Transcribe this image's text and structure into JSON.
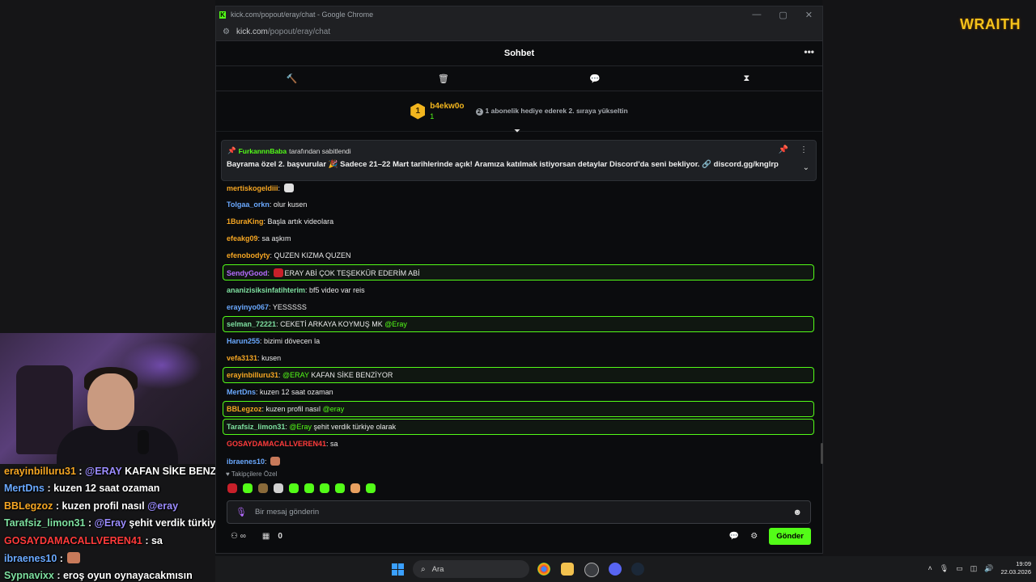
{
  "overlay": {
    "brand": "WRAITH",
    "chat": [
      {
        "user": "erayinbilluru31",
        "sep": " : ",
        "mention": "@ERAY",
        "text": " KAFAN SİKE BENZİYOR",
        "color": "#f5a623"
      },
      {
        "user": "MertDns",
        "sep": " : ",
        "mention": "",
        "text": "kuzen 12 saat ozaman",
        "color": "#6aa9ff"
      },
      {
        "user": "BBLegzoz",
        "sep": " : ",
        "mention": "",
        "text": "kuzen profil nasıl ",
        "mention2": "@eray",
        "color": "#f5a623"
      },
      {
        "user": "Tarafsiz_limon31",
        "sep": " : ",
        "mention": "@Eray",
        "text": " şehit verdik türkiye olara",
        "color": "#7ee0a0"
      },
      {
        "user": "GOSAYDAMACALLVEREN41",
        "sep": " : ",
        "mention": "",
        "text": "sa",
        "color": "#ff3b3b"
      },
      {
        "user": "ibraenes10",
        "sep": " : ",
        "mention": "",
        "text": "",
        "color": "#6aa9ff"
      },
      {
        "user": "Sypnavixx",
        "sep": " : ",
        "mention": "",
        "text": "eroş oyun oynayacakmısın",
        "color": "#7ee0a0"
      }
    ]
  },
  "browser": {
    "title": "kick.com/popout/eray/chat - Google Chrome",
    "url_host": "kick.com",
    "url_path": "/popout/eray/chat"
  },
  "chat": {
    "header": "Sohbet",
    "leaderboard": {
      "rank": "1",
      "name": "b4ekw0o",
      "count": "1",
      "promo": "1 abonelik hediye ederek 2. sıraya yükseltin"
    },
    "pinned": {
      "by_user": "FurkannnBaba",
      "by_suffix": "tarafından sabitlendi",
      "message": "Bayrama özel 2. başvurular 🎉 Sadece 21–22 Mart tarihlerinde açık! Aramıza katılmak istiyorsan detaylar Discord'da seni bekliyor. 🔗 discord.gg/knglrp"
    },
    "messages": [
      {
        "user": "mertiskogeldiii",
        "text": "",
        "color": "#f5a623",
        "hl": false
      },
      {
        "user": "Tolgaa_orkn",
        "text": "olur kusen",
        "color": "#6aa9ff",
        "hl": false
      },
      {
        "user": "1BuraKing",
        "text": "Başla artık videolara",
        "color": "#f5a623",
        "hl": false
      },
      {
        "user": "efeakg09",
        "text": "sa aşkım",
        "color": "#f5a623",
        "hl": false
      },
      {
        "user": "efenobodyty",
        "text": "QUZEN KIZMA QUZEN",
        "color": "#f5a623",
        "hl": false
      },
      {
        "user": "SendyGood",
        "text": "ERAY ABİ ÇOK TEŞEKKÜR EDERİM ABİ",
        "color": "#b56bff",
        "hl": true
      },
      {
        "user": "ananizisiksinfatihterim",
        "text": "bf5 video var reis",
        "color": "#7ee0a0",
        "hl": false
      },
      {
        "user": "erayinyo067",
        "text": "YESSSSS",
        "color": "#6aa9ff",
        "hl": false
      },
      {
        "user": "selman_72221",
        "text": "CEKETİ ARKAYA KOYMUŞ MK ",
        "mention": "@Eray",
        "color": "#7ee0a0",
        "hl": true
      },
      {
        "user": "Harun255",
        "text": "bizimi dövecen la",
        "color": "#6aa9ff",
        "hl": false
      },
      {
        "user": "vefa3131",
        "text": "kusen",
        "color": "#f5a623",
        "hl": false
      },
      {
        "user": "erayinbilluru31",
        "text": " KAFAN SİKE BENZİYOR",
        "mentionFirst": "@ERAY",
        "color": "#f5a623",
        "hl": true
      },
      {
        "user": "MertDns",
        "text": "kuzen 12 saat ozaman",
        "color": "#6aa9ff",
        "hl": false
      },
      {
        "user": "BBLegzoz",
        "text": "kuzen profil nasıl ",
        "mention": "@eray",
        "color": "#f5a623",
        "hl": true
      },
      {
        "user": "Tarafsiz_limon31",
        "text": " şehit verdik türkiye olarak",
        "mentionFirst": "@Eray",
        "color": "#7ee0a0",
        "hl": true
      },
      {
        "user": "GOSAYDAMACALLVEREN41",
        "text": "sa",
        "color": "#ff3b3b",
        "hl": false
      },
      {
        "user": "ibraenes10",
        "text": "",
        "color": "#6aa9ff",
        "hl": false
      }
    ],
    "followers_label": "Takipçilere Özel",
    "input_placeholder": "Bir mesaj gönderin",
    "points": "0",
    "send_label": "Gönder"
  },
  "taskbar": {
    "search": "Ara",
    "time": "19:09",
    "date": "22.03.2026"
  },
  "colors": {
    "accent": "#53fc18",
    "brand": "#f5c21b"
  },
  "icons": [
    "kick-icon",
    "minimize-icon",
    "maximize-icon",
    "close-icon",
    "tune-icon",
    "more-icon",
    "gavel-icon",
    "trash-icon",
    "chat-bubble-icon",
    "hourglass-icon",
    "pin-icon",
    "chevron-down-icon",
    "mic-icon",
    "smile-icon",
    "gear-icon",
    "search-icon",
    "windows-icon",
    "chrome-icon",
    "files-icon",
    "steam-icon",
    "discord-icon"
  ]
}
